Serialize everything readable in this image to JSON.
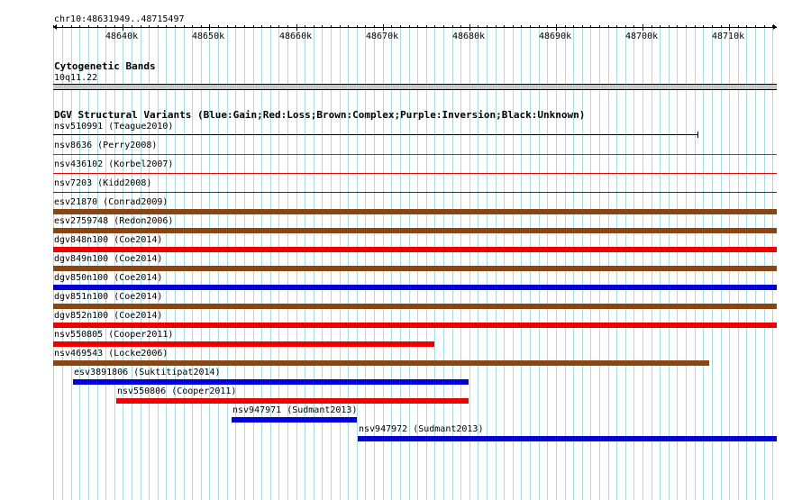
{
  "coord_label": "chr10:48631949..48715497",
  "ruler": {
    "start": 48631949,
    "end": 48715497,
    "ticks": [
      "48640k",
      "48650k",
      "48660k",
      "48670k",
      "48680k",
      "48690k",
      "48700k",
      "48710k"
    ],
    "tick_values": [
      48640000,
      48650000,
      48660000,
      48670000,
      48680000,
      48690000,
      48700000,
      48710000
    ]
  },
  "cyto": {
    "title": "Cytogenetic Bands",
    "band": "10q11.22"
  },
  "dgv": {
    "title": "DGV Structural Variants (Blue:Gain;Red:Loss;Brown:Complex;Purple:Inversion;Black:Unknown)",
    "colors": {
      "gain": "#0000dd",
      "loss": "#ee0000",
      "complex": "#8b4513",
      "inversion": "#800080",
      "unknown": "#000000"
    },
    "variants": [
      {
        "label": "nsv510991 (Teague2010)",
        "type": "unknown",
        "start": 48631949,
        "end": 48706400,
        "style": "line"
      },
      {
        "label": "nsv8636 (Perry2008)",
        "type": "complex",
        "start": 48631949,
        "end": 48715497,
        "style": "thin"
      },
      {
        "label": "nsv436102 (Korbel2007)",
        "type": "loss",
        "start": 48631949,
        "end": 48715497,
        "style": "thin"
      },
      {
        "label": "nsv7203 (Kidd2008)",
        "type": "inversion",
        "start": 48631949,
        "end": 48715497,
        "style": "thin"
      },
      {
        "label": "esv21870 (Conrad2009)",
        "type": "complex",
        "start": 48631949,
        "end": 48715497,
        "style": "thick"
      },
      {
        "label": "esv2759748 (Redon2006)",
        "type": "complex",
        "start": 48631949,
        "end": 48715497,
        "style": "thick"
      },
      {
        "label": "dgv848n100 (Coe2014)",
        "type": "loss",
        "start": 48631949,
        "end": 48715497,
        "style": "thick"
      },
      {
        "label": "dgv849n100 (Coe2014)",
        "type": "complex",
        "start": 48631949,
        "end": 48715497,
        "style": "thick"
      },
      {
        "label": "dgv850n100 (Coe2014)",
        "type": "gain",
        "start": 48631949,
        "end": 48715497,
        "style": "thick"
      },
      {
        "label": "dgv851n100 (Coe2014)",
        "type": "complex",
        "start": 48631949,
        "end": 48715497,
        "style": "thick"
      },
      {
        "label": "dgv852n100 (Coe2014)",
        "type": "loss",
        "start": 48631949,
        "end": 48715497,
        "style": "thick"
      },
      {
        "label": "nsv550805 (Cooper2011)",
        "type": "loss",
        "start": 48631949,
        "end": 48675950,
        "style": "thick"
      },
      {
        "label": "nsv469543 (Locke2006)",
        "type": "complex",
        "start": 48631949,
        "end": 48707700,
        "style": "thick"
      },
      {
        "label": "esv3891806 (Suktitipat2014)",
        "type": "gain",
        "start": 48634200,
        "end": 48679900,
        "style": "thick"
      },
      {
        "label": "nsv550806 (Cooper2011)",
        "type": "loss",
        "start": 48639200,
        "end": 48679900,
        "style": "thick"
      },
      {
        "label": "nsv947971 (Sudmant2013)",
        "type": "gain",
        "start": 48652600,
        "end": 48667100,
        "style": "thick"
      },
      {
        "label": "nsv947972 (Sudmant2013)",
        "type": "gain",
        "start": 48667100,
        "end": 48715497,
        "style": "thick"
      }
    ]
  }
}
